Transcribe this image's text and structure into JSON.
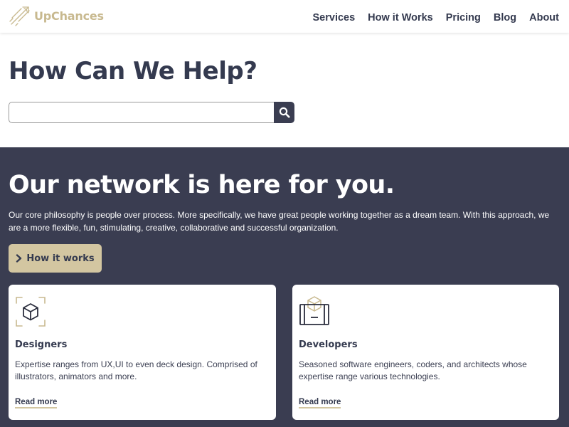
{
  "brand": {
    "name": "UpChances",
    "logo_icon": "rocket-icon",
    "accent": "#c8b98f"
  },
  "nav": {
    "items": [
      "Services",
      "How it Works",
      "Pricing",
      "Blog",
      "About"
    ]
  },
  "hero": {
    "title": "How Can We Help?",
    "search_placeholder": "",
    "search_icon": "search-icon"
  },
  "network": {
    "title": "Our network is here for you.",
    "description": "Our core philosophy is people over process. More specifically, we have great people working together as a dream team. With this approach, we are a more flexible, fun, stimulating, creative, collaborative and successful organization.",
    "button_label": "How it works",
    "button_icon": "chevron-right-icon"
  },
  "cards": [
    {
      "title": "Designers",
      "icon": "cube-frame-icon",
      "text": "Expertise ranges from UX,UI to even deck design. Comprised of illustrators, animators and more.",
      "link": "Read more"
    },
    {
      "title": "Developers",
      "icon": "package-box-icon",
      "text": "Seasoned software engineers, coders, and architects whose expertise range various technologies.",
      "link": "Read more"
    }
  ],
  "colors": {
    "dark_bg": "#3a3d51",
    "button_bg": "#d3c6a1",
    "text_dark": "#343a4f"
  }
}
